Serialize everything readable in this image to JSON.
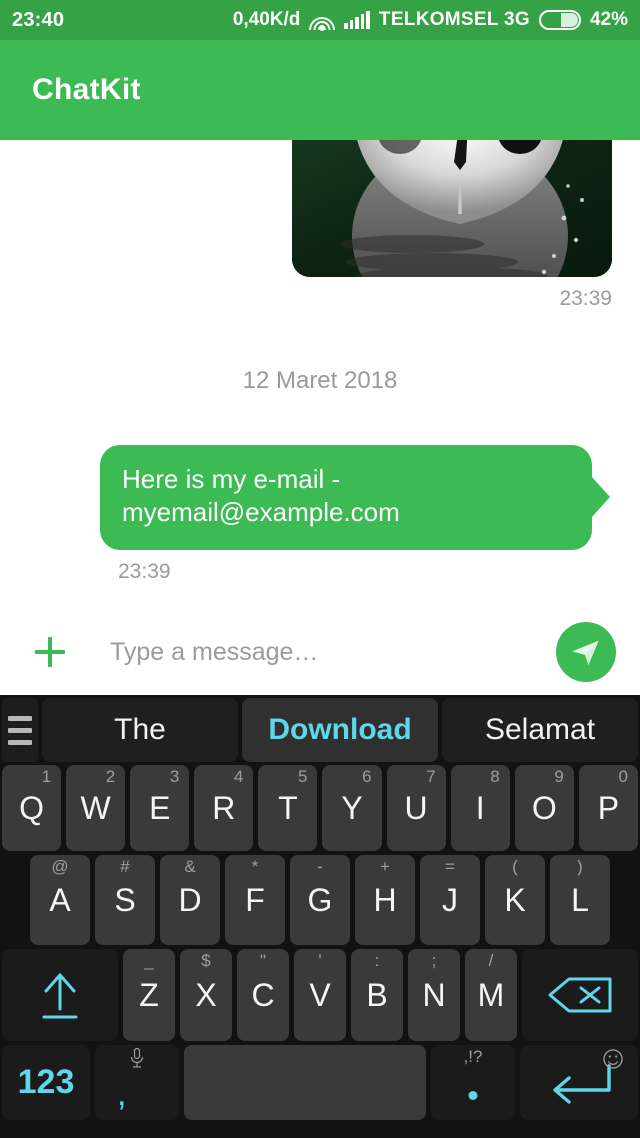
{
  "status_bar": {
    "time": "23:40",
    "data_rate": "0,40K/d",
    "wifi_icon": "wifi-icon",
    "signal_icon": "signal-bars-icon",
    "carrier": "TELKOMSEL 3G",
    "battery_icon": "battery-icon",
    "battery_percent": "42%",
    "bg_color": "#36a246"
  },
  "app_bar": {
    "title": "ChatKit",
    "bg_color": "#3cba54"
  },
  "chat": {
    "messages": [
      {
        "type": "image",
        "alt": "owl-photo",
        "timestamp": "23:39",
        "align": "right"
      },
      {
        "type": "date_separator",
        "text": "12 Maret 2018"
      },
      {
        "type": "text",
        "text": "Here is my e-mail - myemail@example.com",
        "timestamp": "23:39",
        "align": "left",
        "bubble_color": "#3cba54",
        "text_color": "#ffffff"
      }
    ]
  },
  "input_bar": {
    "attach_icon": "plus-icon",
    "placeholder": "Type a message…",
    "value": "",
    "send_icon": "send-paper-plane-icon",
    "send_color": "#3cba54"
  },
  "keyboard": {
    "menu_icon": "hamburger-menu-icon",
    "suggestions": [
      {
        "label": "The",
        "active": false
      },
      {
        "label": "Download",
        "active": true
      },
      {
        "label": "Selamat",
        "active": false
      }
    ],
    "accent_color": "#5fd7e8",
    "row1": [
      {
        "key": "Q",
        "hint": "1"
      },
      {
        "key": "W",
        "hint": "2"
      },
      {
        "key": "E",
        "hint": "3"
      },
      {
        "key": "R",
        "hint": "4"
      },
      {
        "key": "T",
        "hint": "5"
      },
      {
        "key": "Y",
        "hint": "6"
      },
      {
        "key": "U",
        "hint": "7"
      },
      {
        "key": "I",
        "hint": "8"
      },
      {
        "key": "O",
        "hint": "9"
      },
      {
        "key": "P",
        "hint": "0"
      }
    ],
    "row2": [
      {
        "key": "A",
        "hint": "@"
      },
      {
        "key": "S",
        "hint": "#"
      },
      {
        "key": "D",
        "hint": "&"
      },
      {
        "key": "F",
        "hint": "*"
      },
      {
        "key": "G",
        "hint": "-"
      },
      {
        "key": "H",
        "hint": "+"
      },
      {
        "key": "J",
        "hint": "="
      },
      {
        "key": "K",
        "hint": "("
      },
      {
        "key": "L",
        "hint": ")"
      }
    ],
    "row3": [
      {
        "key": "Z",
        "hint": "_"
      },
      {
        "key": "X",
        "hint": "$"
      },
      {
        "key": "C",
        "hint": "\""
      },
      {
        "key": "V",
        "hint": "'"
      },
      {
        "key": "B",
        "hint": ":"
      },
      {
        "key": "N",
        "hint": ";"
      },
      {
        "key": "M",
        "hint": "/"
      }
    ],
    "shift_icon": "shift-arrow-icon",
    "backspace_icon": "backspace-icon",
    "row4": {
      "numeric_label": "123",
      "comma_label": ",",
      "mic_icon": "microphone-icon",
      "space_label": "",
      "period_hint": ",!?",
      "period_label": ".",
      "smiley_icon": "smiley-icon",
      "enter_icon": "enter-return-icon"
    }
  }
}
